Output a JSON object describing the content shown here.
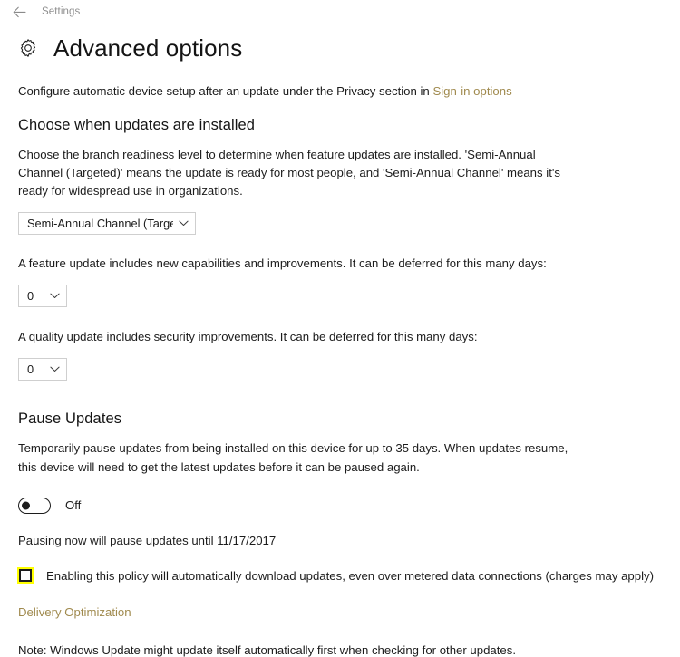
{
  "titlebar": {
    "back_icon": "back-arrow-icon",
    "label": "Settings"
  },
  "header": {
    "icon": "gear-icon",
    "title": "Advanced options"
  },
  "intro": {
    "text_before_link": "Configure automatic device setup after an update under the Privacy section in ",
    "link_label": "Sign-in options"
  },
  "choose_when": {
    "heading": "Choose when updates are installed",
    "description": "Choose the branch readiness level to determine when feature updates are installed. 'Semi-Annual Channel (Targeted)' means the update is ready for most people, and 'Semi-Annual Channel' means it's ready for widespread use in organizations.",
    "branch_dropdown": {
      "value": "Semi-Annual Channel (Targeted)",
      "chevron_icon": "chevron-down-icon"
    },
    "feature_defer_text": "A feature update includes new capabilities and improvements. It can be deferred for this many days:",
    "feature_defer_dropdown": {
      "value": "0",
      "chevron_icon": "chevron-down-icon"
    },
    "quality_defer_text": "A quality update includes security improvements. It can be deferred for this many days:",
    "quality_defer_dropdown": {
      "value": "0",
      "chevron_icon": "chevron-down-icon"
    }
  },
  "pause_updates": {
    "heading": "Pause Updates",
    "description": "Temporarily pause updates from being installed on this device for up to 35 days. When updates resume, this device will need to get the latest updates before it can be paused again.",
    "toggle": {
      "state": "Off",
      "checked": false
    },
    "pause_until_text": "Pausing now will pause updates until 11/17/2017"
  },
  "metered_policy": {
    "checked": false,
    "highlight_color": "#ffff00",
    "label": "Enabling this policy will automatically download updates, even over metered data connections (charges may apply)"
  },
  "delivery_optimization": {
    "link_label": "Delivery Optimization"
  },
  "footer": {
    "note": "Note: Windows Update might update itself automatically first when checking for other updates."
  },
  "colors": {
    "link": "#a08a4e",
    "highlight": "#ffff00",
    "text": "#1c1c1c",
    "background": "#ffffff"
  }
}
